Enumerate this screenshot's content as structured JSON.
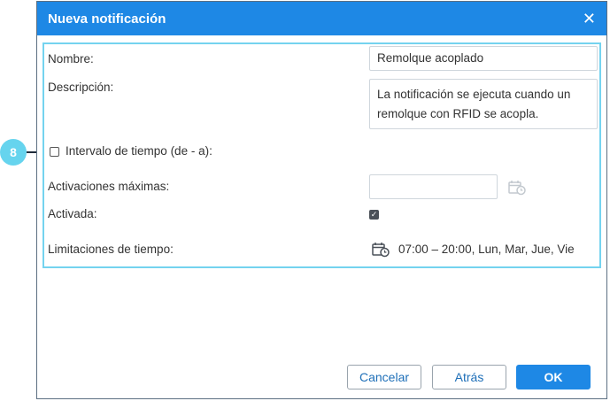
{
  "callout": {
    "number": "8"
  },
  "dialog": {
    "title": "Nueva notificación",
    "close_glyph": "✕"
  },
  "form": {
    "name_label": "Nombre:",
    "name_value": "Remolque acoplado",
    "description_label": "Descripción:",
    "description_value": "La notificación se ejecuta cuando un remolque con RFID se acopla.",
    "interval_label": "Intervalo de tiempo (de - a):",
    "interval_checked": false,
    "max_activations_label": "Activaciones máximas:",
    "max_activations_value": "",
    "enabled_label": "Activada:",
    "enabled_checked": true,
    "time_limits_label": "Limitaciones de tiempo:",
    "time_limits_value": "07:00 – 20:00, Lun, Mar, Jue, Vie"
  },
  "buttons": {
    "cancel": "Cancelar",
    "back": "Atrás",
    "ok": "OK"
  },
  "colors": {
    "accent": "#1e88e5",
    "highlight": "#74d3ef",
    "callout": "#66d4ee"
  }
}
